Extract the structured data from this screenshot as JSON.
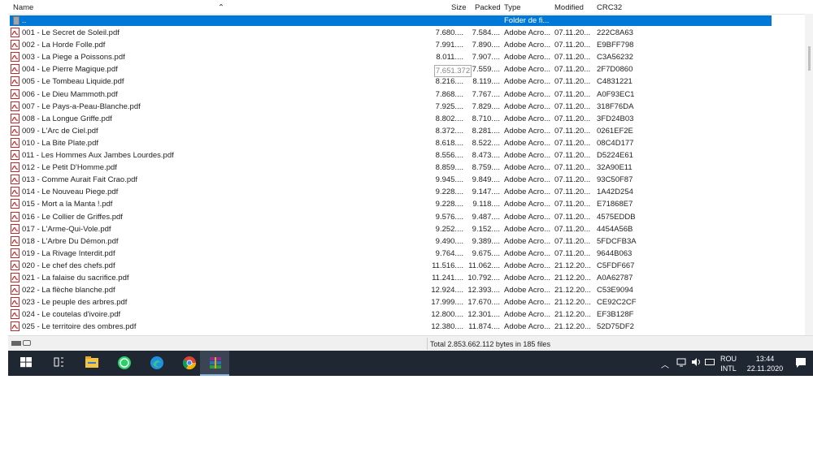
{
  "columns": {
    "name": "Name",
    "size": "Size",
    "packed": "Packed",
    "type": "Type",
    "modified": "Modified",
    "crc32": "CRC32"
  },
  "selected_row": {
    "name": "..",
    "type": "Folder de fi..."
  },
  "files": [
    {
      "name": "001 - Le Secret de Soleil.pdf",
      "size": "7.680....",
      "packed": "7.584....",
      "type": "Adobe Acro...",
      "modified": "07.11.20...",
      "crc": "222C8A63"
    },
    {
      "name": "002 - La Horde Folle.pdf",
      "size": "7.991....",
      "packed": "7.890....",
      "type": "Adobe Acro...",
      "modified": "07.11.20...",
      "crc": "E9BFF798"
    },
    {
      "name": "003 - La Piege a Poissons.pdf",
      "size": "8.011....",
      "packed": "7.907....",
      "type": "Adobe Acro...",
      "modified": "07.11.20...",
      "crc": "C3A56232"
    },
    {
      "name": "004 - Le Pierre Magique.pdf",
      "size": "",
      "packed": "7.559....",
      "type": "Adobe Acro...",
      "modified": "07.11.20...",
      "crc": "2F7D0860"
    },
    {
      "name": "005 - Le Tombeau Liquide.pdf",
      "size": "8.216....",
      "packed": "8.119....",
      "type": "Adobe Acro...",
      "modified": "07.11.20...",
      "crc": "C4831221"
    },
    {
      "name": "006 - Le Dieu Mammoth.pdf",
      "size": "7.868....",
      "packed": "7.767....",
      "type": "Adobe Acro...",
      "modified": "07.11.20...",
      "crc": "A0F93EC1"
    },
    {
      "name": "007 - Le Pays-a-Peau-Blanche.pdf",
      "size": "7.925....",
      "packed": "7.829....",
      "type": "Adobe Acro...",
      "modified": "07.11.20...",
      "crc": "318F76DA"
    },
    {
      "name": "008 - La Longue Griffe.pdf",
      "size": "8.802....",
      "packed": "8.710....",
      "type": "Adobe Acro...",
      "modified": "07.11.20...",
      "crc": "3FD24B03"
    },
    {
      "name": "009 - L'Arc de Ciel.pdf",
      "size": "8.372....",
      "packed": "8.281....",
      "type": "Adobe Acro...",
      "modified": "07.11.20...",
      "crc": "0261EF2E"
    },
    {
      "name": "010 - La Bite Plate.pdf",
      "size": "8.618....",
      "packed": "8.522....",
      "type": "Adobe Acro...",
      "modified": "07.11.20...",
      "crc": "08C4D177"
    },
    {
      "name": "011 - Les Hommes Aux Jambes Lourdes.pdf",
      "size": "8.556....",
      "packed": "8.473....",
      "type": "Adobe Acro...",
      "modified": "07.11.20...",
      "crc": "D5224E61"
    },
    {
      "name": "012 - Le Petit D'Homme.pdf",
      "size": "8.859....",
      "packed": "8.759....",
      "type": "Adobe Acro...",
      "modified": "07.11.20...",
      "crc": "32A90E11"
    },
    {
      "name": "013 - Comme Aurait Fait Crao.pdf",
      "size": "9.945....",
      "packed": "9.849....",
      "type": "Adobe Acro...",
      "modified": "07.11.20...",
      "crc": "93C50F87"
    },
    {
      "name": "014 - Le Nouveau Piege.pdf",
      "size": "9.228....",
      "packed": "9.147....",
      "type": "Adobe Acro...",
      "modified": "07.11.20...",
      "crc": "1A42D254"
    },
    {
      "name": "015 - Mort a la Manta !.pdf",
      "size": "9.228....",
      "packed": "9.118....",
      "type": "Adobe Acro...",
      "modified": "07.11.20...",
      "crc": "E71868E7"
    },
    {
      "name": "016 - Le Collier de Griffes.pdf",
      "size": "9.576....",
      "packed": "9.487....",
      "type": "Adobe Acro...",
      "modified": "07.11.20...",
      "crc": "4575EDDB"
    },
    {
      "name": "017 - L'Arme-Qui-Vole.pdf",
      "size": "9.252....",
      "packed": "9.152....",
      "type": "Adobe Acro...",
      "modified": "07.11.20...",
      "crc": "4454A56B"
    },
    {
      "name": "018 - L'Arbre Du Démon.pdf",
      "size": "9.490....",
      "packed": "9.389....",
      "type": "Adobe Acro...",
      "modified": "07.11.20...",
      "crc": "5FDCFB3A"
    },
    {
      "name": "019 - La Rivage Interdit.pdf",
      "size": "9.764....",
      "packed": "9.675....",
      "type": "Adobe Acro...",
      "modified": "07.11.20...",
      "crc": "9644B063"
    },
    {
      "name": "020 - Le chef des chefs.pdf",
      "size": "11.516....",
      "packed": "11.062....",
      "type": "Adobe Acro...",
      "modified": "21.12.20...",
      "crc": "C5FDF667"
    },
    {
      "name": "021 - La falaise du sacrifice.pdf",
      "size": "11.241....",
      "packed": "10.792....",
      "type": "Adobe Acro...",
      "modified": "21.12.20...",
      "crc": "A0A62787"
    },
    {
      "name": "022 - La flèche blanche.pdf",
      "size": "12.924....",
      "packed": "12.393....",
      "type": "Adobe Acro...",
      "modified": "21.12.20...",
      "crc": "C53E9094"
    },
    {
      "name": "023 - Le peuple des arbres.pdf",
      "size": "17.999....",
      "packed": "17.670....",
      "type": "Adobe Acro...",
      "modified": "21.12.20...",
      "crc": "CE92C2CF"
    },
    {
      "name": "024 - Le coutelas d'ivoire.pdf",
      "size": "12.800....",
      "packed": "12.301....",
      "type": "Adobe Acro...",
      "modified": "21.12.20...",
      "crc": "EF3B128F"
    },
    {
      "name": "025 - Le territoire des ombres.pdf",
      "size": "12.380....",
      "packed": "11.874....",
      "type": "Adobe Acro...",
      "modified": "21.12.20...",
      "crc": "52D75DF2"
    }
  ],
  "tooltip": "7.651.372",
  "status": {
    "total": "Total 2.853.662.112 bytes in 185 files"
  },
  "taskbar": {
    "apps": [
      "windows-start",
      "task-view",
      "file-explorer",
      "whatsapp",
      "edge",
      "chrome",
      "winrar"
    ],
    "language": [
      "ROU",
      "INTL"
    ],
    "time": "13:44",
    "date": "22.11.2020"
  },
  "colors": {
    "selection": "#0078d7",
    "taskbar": "#1f2733",
    "pdf_icon": "#c62828"
  }
}
